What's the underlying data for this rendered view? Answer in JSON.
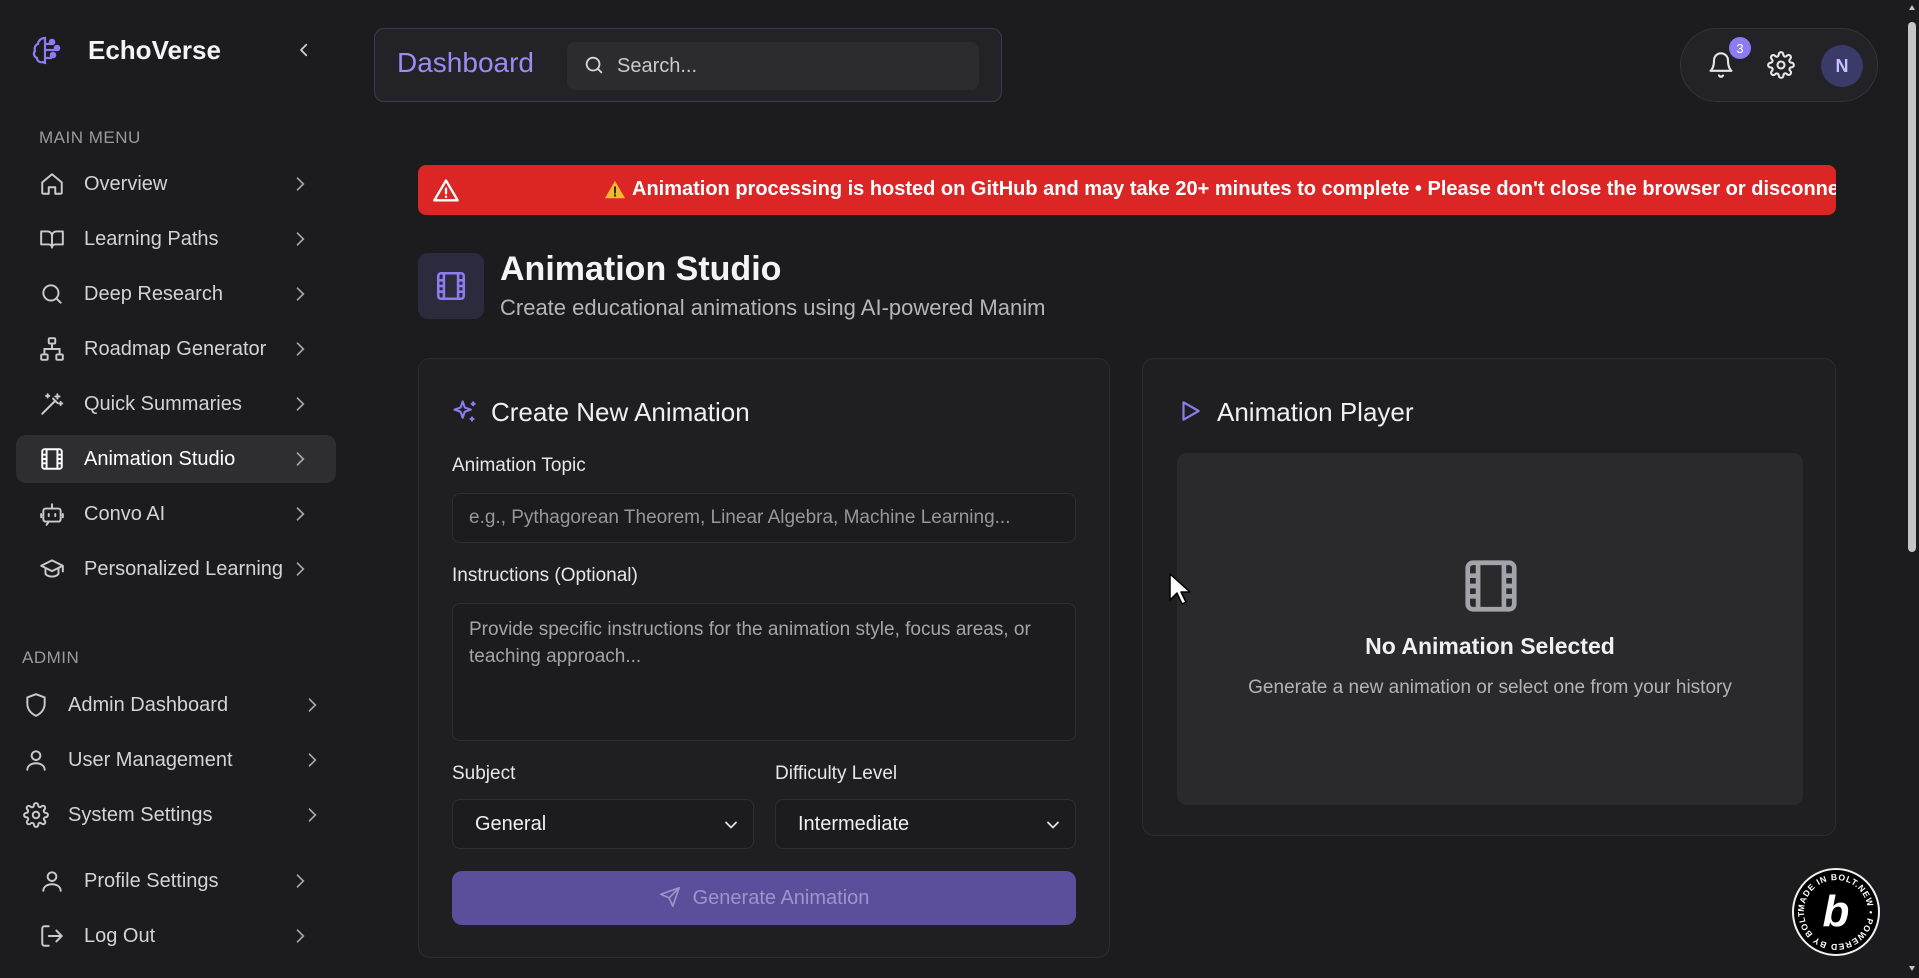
{
  "app": {
    "name": "EchoVerse",
    "colors": {
      "accent": "#8b7cf0",
      "active_indicator": "#34d27a",
      "warning": "#dc2626",
      "background": "#1c1c1e"
    }
  },
  "sidebar": {
    "main_menu_label": "MAIN MENU",
    "main_items": [
      {
        "label": "Overview",
        "icon": "home-icon"
      },
      {
        "label": "Learning Paths",
        "icon": "book-open-icon"
      },
      {
        "label": "Deep Research",
        "icon": "search-icon"
      },
      {
        "label": "Roadmap Generator",
        "icon": "sitemap-icon"
      },
      {
        "label": "Quick Summaries",
        "icon": "magic-wand-icon"
      },
      {
        "label": "Animation Studio",
        "icon": "film-icon",
        "active": true
      },
      {
        "label": "Convo AI",
        "icon": "bot-icon"
      },
      {
        "label": "Personalized Learning",
        "icon": "graduation-cap-icon"
      }
    ],
    "admin_label": "ADMIN",
    "admin_items": [
      {
        "label": "Admin Dashboard",
        "icon": "shield-icon"
      },
      {
        "label": "User Management",
        "icon": "user-icon"
      },
      {
        "label": "System Settings",
        "icon": "gear-icon"
      }
    ],
    "bottom_items": [
      {
        "label": "Profile Settings",
        "icon": "user-icon"
      },
      {
        "label": "Log Out",
        "icon": "logout-icon"
      }
    ]
  },
  "header": {
    "title": "Dashboard",
    "search_placeholder": "Search...",
    "notification_count": "3",
    "avatar_initial": "N"
  },
  "warning": {
    "text": "Animation processing is hosted on GitHub and may take 20+ minutes to complete • Please don't close the browser or disconnect fr"
  },
  "page": {
    "title": "Animation Studio",
    "subtitle": "Create educational animations using AI-powered Manim"
  },
  "create_card": {
    "title": "Create New Animation",
    "topic_label": "Animation Topic",
    "topic_placeholder": "e.g., Pythagorean Theorem, Linear Algebra, Machine Learning...",
    "topic_value": "",
    "instructions_label": "Instructions (Optional)",
    "instructions_placeholder": "Provide specific instructions for the animation style, focus areas, or teaching approach...",
    "subject_label": "Subject",
    "subject_value": "General",
    "difficulty_label": "Difficulty Level",
    "difficulty_value": "Intermediate",
    "generate_label": "Generate Animation"
  },
  "player_card": {
    "title": "Animation Player",
    "empty_title": "No Animation Selected",
    "empty_subtitle": "Generate a new animation or select one from your history"
  },
  "bolt_badge": {
    "letter": "b",
    "ring_text": "MADE IN BOLT.NEW • POWERED BY BOLT.NEW •"
  }
}
